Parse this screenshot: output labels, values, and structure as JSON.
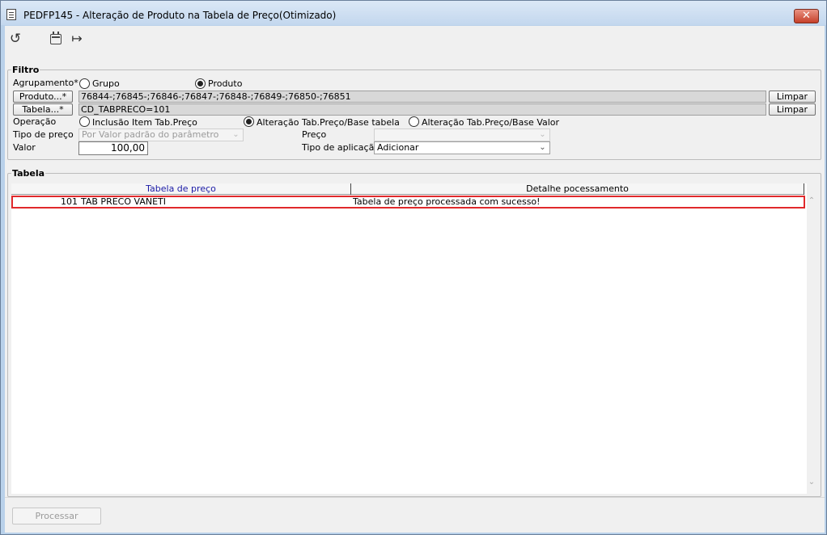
{
  "window": {
    "title": "PEDFP145 - Alteração de Produto na Tabela de Preço(Otimizado)",
    "close_glyph": "✕"
  },
  "toolbar": {
    "refresh_icon": "↺",
    "calendar_icon": "calendar-icon",
    "exit_icon": "↦"
  },
  "filtro": {
    "title": "Filtro",
    "agrupamento_label": "Agrupamento*",
    "grupo_label": "Grupo",
    "produto_label": "Produto",
    "produto_button": "Produto...*",
    "produto_value": "76844-;76845-;76846-;76847-;76848-;76849-;76850-;76851",
    "tabela_button": "Tabela...*",
    "tabela_value": "CD_TABPRECO=101",
    "limpar_label": "Limpar",
    "operacao_label": "Operação",
    "op_inclusao": "Inclusão Item Tab.Preço",
    "op_alt_base_tabela": "Alteração Tab.Preço/Base tabela",
    "op_alt_base_valor": "Alteração Tab.Preço/Base Valor",
    "tipo_preco_label": "Tipo de preço",
    "tipo_preco_value": "Por Valor padrão do parâmetro",
    "preco_label": "Preço",
    "preco_value": "",
    "valor_label": "Valor",
    "valor_value": "100,00",
    "tipo_aplicacao_label": "Tipo de aplicação",
    "tipo_aplicacao_value": "Adicionar",
    "agrupamento_selected": "Produto",
    "operacao_selected": "Alteração Tab.Preço/Base tabela"
  },
  "tabela": {
    "title": "Tabela",
    "columns": [
      "Tabela de preço",
      "Detalhe pocessamento"
    ],
    "rows": [
      {
        "codigo": "101",
        "nome": "TAB PRECO VANETI",
        "detalhe": "Tabela de preço processada com sucesso!"
      }
    ]
  },
  "footer": {
    "processar_label": "Processar"
  },
  "colors": {
    "highlight_border": "#e0292c",
    "header_link": "#1a1aa6",
    "close_button": "#c6402a"
  }
}
